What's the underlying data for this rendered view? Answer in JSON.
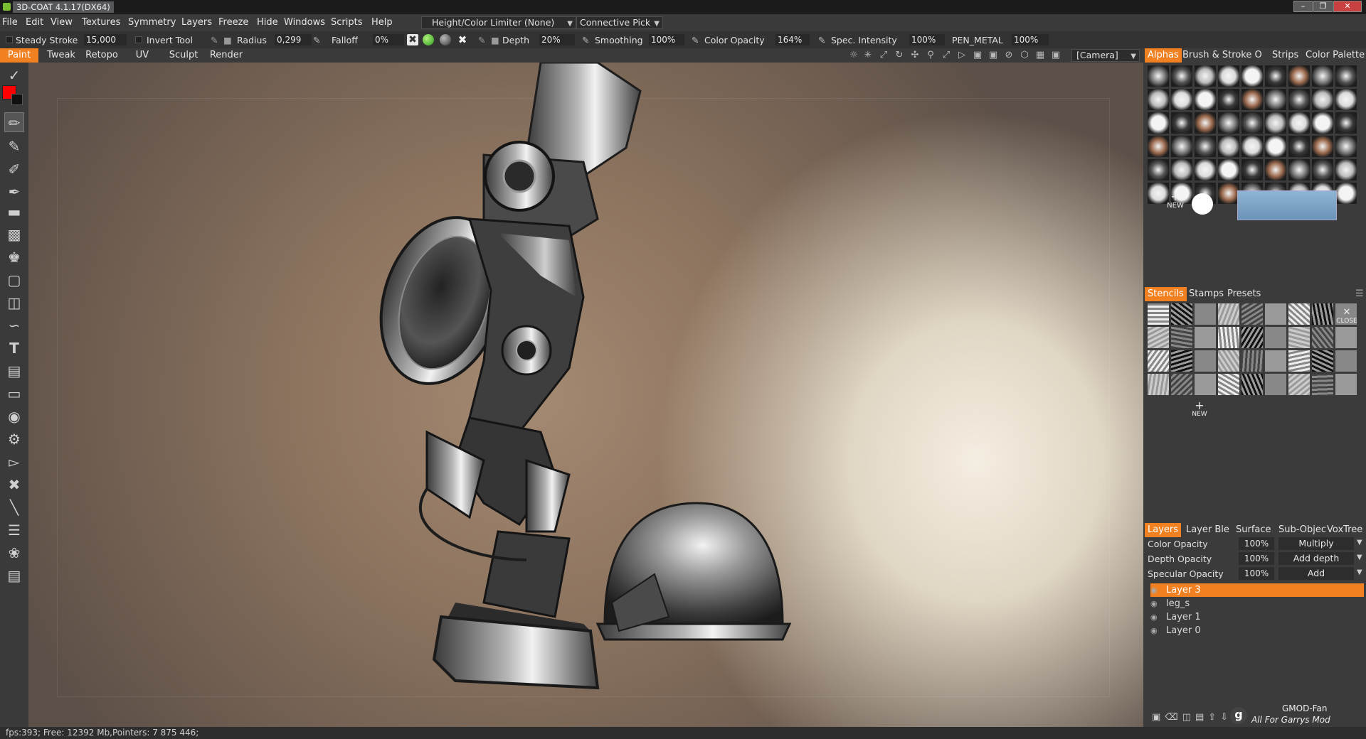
{
  "window": {
    "title": "3D-COAT 4.1.17(DX64)"
  },
  "menu": [
    "File",
    "Edit",
    "View",
    "Textures",
    "Symmetry",
    "Layers",
    "Freeze",
    "Hide",
    "Windows",
    "Scripts",
    "Help"
  ],
  "limiter_combo": "Height/Color Limiter (None)",
  "pick_combo": "Connective Pick",
  "toolbar": {
    "steady_stroke_label": "Steady Stroke",
    "steady_stroke_value": "15,000",
    "invert_tool_label": "Invert Tool",
    "radius_label": "Radius",
    "radius_value": "0,299",
    "falloff_label": "Falloff",
    "falloff_value": "0%",
    "depth_label": "Depth",
    "depth_value": "20%",
    "smoothing_label": "Smoothing",
    "smoothing_value": "100%",
    "color_opacity_label": "Color Opacity",
    "color_opacity_value": "164%",
    "spec_intensity_label": "Spec. Intensity",
    "spec_intensity_value": "100%",
    "material_label": "PEN_METAL",
    "material_value": "100%"
  },
  "rooms": [
    "Paint",
    "Tweak",
    "Retopo",
    "UV",
    "Sculpt",
    "Render"
  ],
  "camera_combo": "[Camera]",
  "alphas_tabs": [
    "Alphas",
    "Brush & Stroke O",
    "Strips",
    "Color Palette"
  ],
  "alphas_new_label": "NEW",
  "stencil_tabs": [
    "Stencils",
    "Stamps",
    "Presets"
  ],
  "stencil_close_label": "CLOSE",
  "stencil_new_label": "NEW",
  "layer_tabs": [
    "Layers",
    "Layer Ble",
    "Surface",
    "Sub-Objec",
    "VoxTree"
  ],
  "layer_props": [
    {
      "label": "Color Opacity",
      "value": "100%",
      "mode": "Multiply"
    },
    {
      "label": "Depth Opacity",
      "value": "100%",
      "mode": "Add depth"
    },
    {
      "label": "Specular Opacity",
      "value": "100%",
      "mode": "Add"
    }
  ],
  "layers": [
    "Layer 3",
    "leg_s",
    "Layer 1",
    "Layer 0"
  ],
  "watermark": {
    "line1": "GMOD-Fan",
    "line2": "All For Garrys Mod"
  },
  "status": "fps:393;   Free: 12392 Mb,Pointers: 7 875 446;",
  "colors": {
    "accent": "#f08020",
    "primary_color": "#ff0000"
  }
}
